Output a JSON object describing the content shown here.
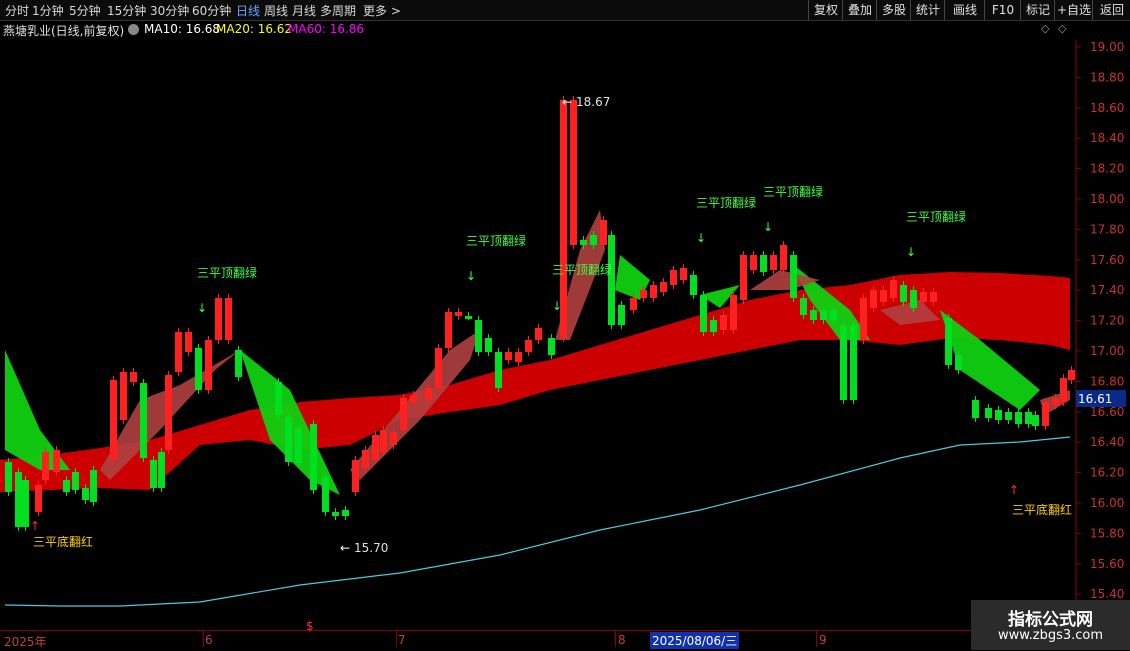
{
  "toolbar": {
    "periods": [
      "分时",
      "1分钟",
      "5分钟",
      "15分钟",
      "30分钟",
      "60分钟",
      "日线",
      "周线",
      "月线",
      "多周期",
      "更多 >"
    ],
    "active_period": "日线",
    "buttons": [
      "复权",
      "叠加",
      "多股",
      "统计",
      "画线",
      "F10",
      "标记",
      "+自选",
      "返回"
    ]
  },
  "info": {
    "stock_name": "燕塘乳业(日线,前复权)",
    "ma10": "MA10: 16.68",
    "ma20": "MA20: 16.62",
    "ma60": "MA60: 16.86",
    "ma10_color": "#ffffff",
    "ma20_color": "#ffff00",
    "ma60_color": "#ff00ff"
  },
  "price_axis": {
    "ticks": [
      "19.00",
      "18.80",
      "18.60",
      "18.40",
      "18.20",
      "18.00",
      "17.80",
      "17.60",
      "17.40",
      "17.20",
      "17.00",
      "16.80",
      "16.60",
      "16.40",
      "16.20",
      "16.00",
      "15.80",
      "15.60",
      "15.40"
    ],
    "current_price": "16.61"
  },
  "annotations": {
    "high_label": "18.67",
    "low_label": "15.70",
    "signal_top": "三平顶翻绿",
    "signal_bottom": "三平底翻红",
    "top_signal_count": 6,
    "bottom_signal_count": 2
  },
  "time_axis": {
    "labels": [
      "2025年",
      "6",
      "7",
      "8",
      "2025/08/06/三",
      "9"
    ],
    "marker": "$"
  },
  "watermark": {
    "title": "指标公式网",
    "url": "www.zbgs3.com"
  },
  "colors": {
    "up": "#ff2020",
    "down": "#00e020",
    "band": "#cc0000",
    "slow_line": "#4fc8d8",
    "signal_top": "#40ff40",
    "signal_bottom": "#ffd000"
  }
}
